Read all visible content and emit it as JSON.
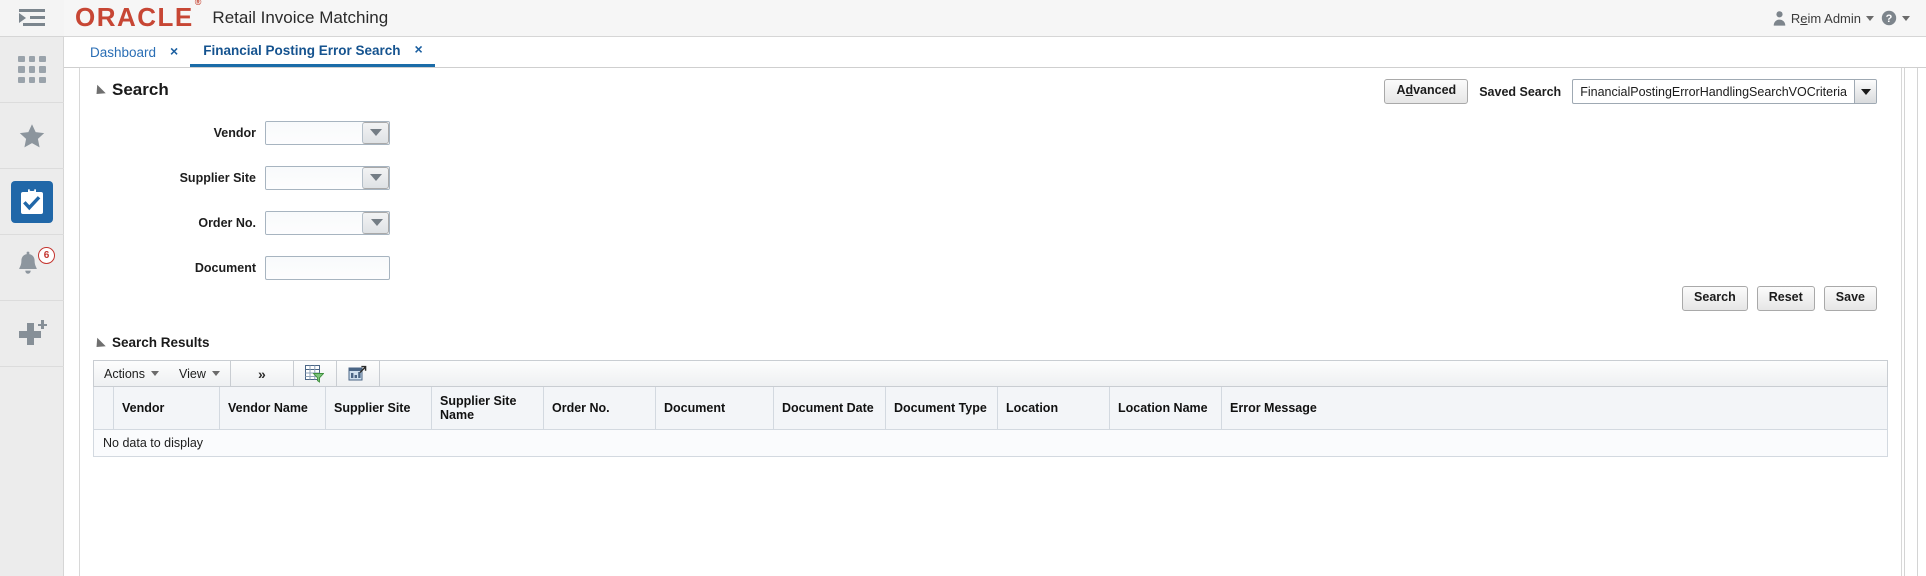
{
  "rail": {
    "items": [
      {
        "name": "menu-toggle",
        "icon": "hamburger-arrow-icon",
        "label": ""
      },
      {
        "name": "apps-grid",
        "icon": "grid-icon",
        "label": ""
      },
      {
        "name": "favorites",
        "icon": "star-icon",
        "label": ""
      },
      {
        "name": "tasks",
        "icon": "clipboard-check-icon",
        "label": ""
      },
      {
        "name": "notifications",
        "icon": "bell-icon",
        "label": "",
        "badge": "6"
      },
      {
        "name": "create",
        "icon": "plus-icon",
        "label": ""
      }
    ],
    "notification_badge": "6"
  },
  "header": {
    "logo": "ORACLE",
    "logo_mark": "®",
    "app_title": "Retail Invoice Matching",
    "user_name_pre": "R",
    "user_name_mnemonic": "e",
    "user_name_post": "im Admin",
    "user_name_full": "Reim Admin",
    "user_icon": "person-icon",
    "help_icon": "help-circle-icon"
  },
  "tabs": [
    {
      "label": "Dashboard",
      "active": false,
      "close": "×"
    },
    {
      "label": "Financial Posting Error Search",
      "active": true,
      "close": "×"
    }
  ],
  "search_region": {
    "title": "Search",
    "advanced_label": "Advanced",
    "saved_search_label": "Saved Search",
    "saved_search_value": "FinancialPostingErrorHandlingSearchVOCriteria",
    "fields": [
      {
        "label": "Vendor",
        "value": "",
        "type": "lov",
        "focused": false
      },
      {
        "label": "Supplier Site",
        "value": "",
        "type": "lov",
        "focused": false
      },
      {
        "label": "Order No.",
        "value": "",
        "type": "lov",
        "focused": true
      },
      {
        "label": "Document",
        "value": "",
        "type": "text",
        "focused": false
      }
    ],
    "buttons": {
      "search": "Search",
      "reset": "Reset",
      "save": "Save"
    }
  },
  "results_region": {
    "title": "Search Results",
    "toolbar": {
      "actions_label": "Actions",
      "view_label": "View",
      "overflow_label": "»",
      "query_icon": "table-filter-icon",
      "detach_icon": "detach-table-icon"
    },
    "columns": [
      "Vendor",
      "Vendor Name",
      "Supplier Site",
      "Supplier Site Name",
      "Order No.",
      "Document",
      "Document Date",
      "Document Type",
      "Location",
      "Location Name",
      "Error Message"
    ],
    "rows": [],
    "empty_text": "No data to display"
  },
  "colors": {
    "oracle_red": "#c74634",
    "tab_active": "#15538f",
    "tab_inactive": "#2a6eb5",
    "tab_underline": "#1b6ca8",
    "tile_blue": "#2067a8",
    "badge_red": "#c4342e",
    "rail_bg": "#ececec"
  }
}
